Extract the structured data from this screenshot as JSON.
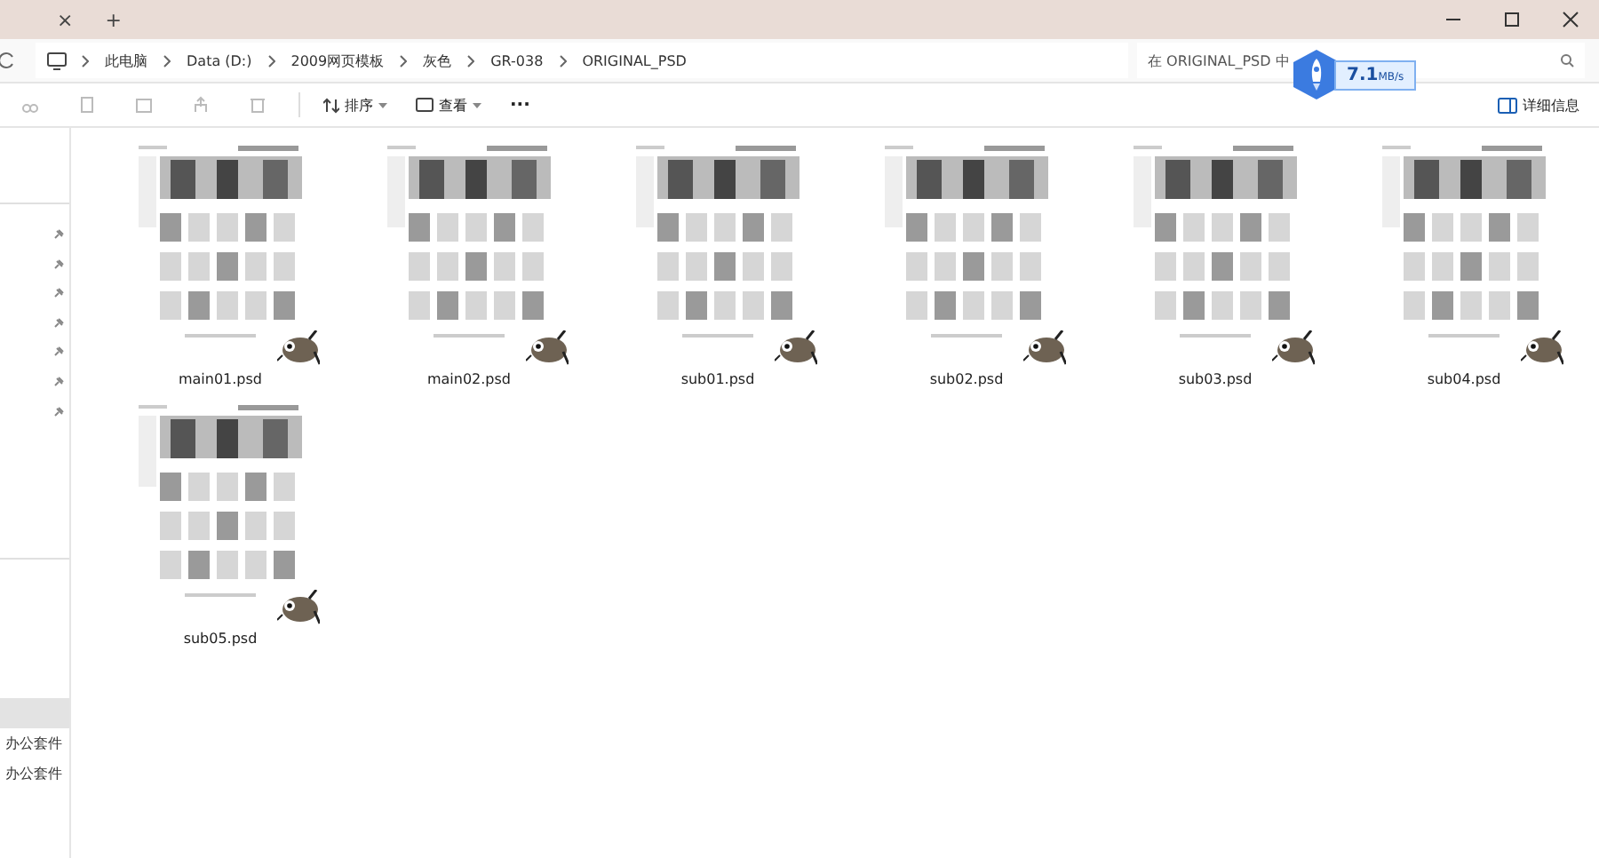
{
  "window": {
    "tab_close": "×",
    "new_tab": "+"
  },
  "address_bar": {
    "breadcrumbs": [
      "此电脑",
      "Data (D:)",
      "2009网页模板",
      "灰色",
      "GR-038",
      "ORIGINAL_PSD"
    ]
  },
  "search": {
    "placeholder": "在 ORIGINAL_PSD 中"
  },
  "speed_widget": {
    "value": "7.1",
    "unit": "MB/s"
  },
  "toolbar": {
    "sort": "排序",
    "view": "查看",
    "more": "···",
    "details": "详细信息"
  },
  "sidebar": {
    "items": [
      {
        "label": "办公套件",
        "selected": false
      },
      {
        "label": "办公套件",
        "selected": false
      }
    ]
  },
  "files": [
    {
      "name": "main01.psd",
      "selected": false
    },
    {
      "name": "main02.psd",
      "selected": false
    },
    {
      "name": "sub01.psd",
      "selected": false
    },
    {
      "name": "sub02.psd",
      "selected": false
    },
    {
      "name": "sub03.psd",
      "selected": false
    },
    {
      "name": "sub04.psd",
      "selected": false
    },
    {
      "name": "sub05.psd",
      "selected": false
    }
  ]
}
